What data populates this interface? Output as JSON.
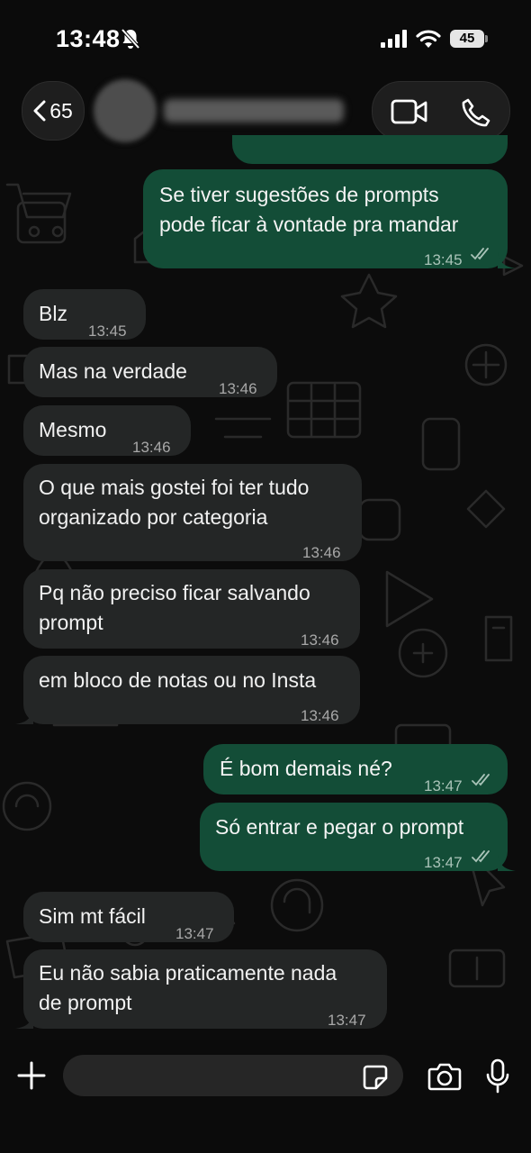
{
  "status_bar": {
    "time": "13:48",
    "battery": "45",
    "icons": [
      "bell-slash-icon",
      "signal-icon",
      "wifi-icon",
      "battery-icon"
    ]
  },
  "header": {
    "back_count": "65",
    "icons": [
      "chevron-left-icon",
      "video-call-icon",
      "phone-call-icon"
    ]
  },
  "messages": [
    {
      "dir": "out",
      "lines": [
        "Se tiver sugestões de prompts",
        "pode ficar à vontade pra mandar"
      ],
      "time": "13:45",
      "read": true
    },
    {
      "dir": "in",
      "lines": [
        "Blz"
      ],
      "time": "13:45"
    },
    {
      "dir": "in",
      "lines": [
        "Mas na verdade"
      ],
      "time": "13:46"
    },
    {
      "dir": "in",
      "lines": [
        "Mesmo"
      ],
      "time": "13:46"
    },
    {
      "dir": "in",
      "lines": [
        "O que mais gostei foi ter tudo",
        "organizado por categoria"
      ],
      "time": "13:46"
    },
    {
      "dir": "in",
      "lines": [
        "Pq não preciso ficar salvando",
        "prompt"
      ],
      "time": "13:46"
    },
    {
      "dir": "in",
      "lines": [
        "em bloco de notas ou no Insta"
      ],
      "time": "13:46"
    },
    {
      "dir": "out",
      "lines": [
        "É bom demais né?"
      ],
      "time": "13:47",
      "read": true
    },
    {
      "dir": "out",
      "lines": [
        "Só entrar e pegar o prompt"
      ],
      "time": "13:47",
      "read": true
    },
    {
      "dir": "in",
      "lines": [
        "Sim mt fácil"
      ],
      "time": "13:47"
    },
    {
      "dir": "in",
      "lines": [
        "Eu não sabia praticamente nada",
        "de prompt"
      ],
      "time": "13:47"
    }
  ],
  "input_bar": {
    "placeholder": "",
    "icons": [
      "plus-icon",
      "sticker-icon",
      "camera-icon",
      "microphone-icon"
    ]
  },
  "colors": {
    "background": "#0b0b0b",
    "incoming_bubble": "#242626",
    "outgoing_bubble": "#134d37",
    "read_ticks": "#a9c3b8"
  }
}
